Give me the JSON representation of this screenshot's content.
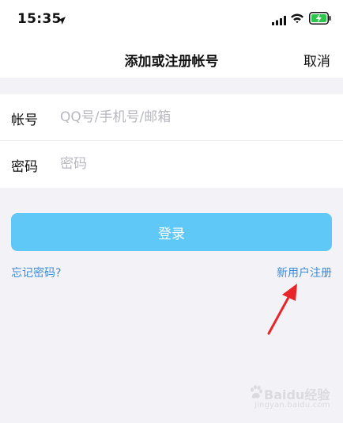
{
  "status_bar": {
    "time": "15:35",
    "icons": [
      "location-arrow-icon",
      "signal-icon",
      "wifi-icon",
      "battery-charging-icon"
    ],
    "battery_color": "#2dc54b"
  },
  "nav": {
    "title": "添加或注册帐号",
    "cancel_label": "取消"
  },
  "form": {
    "account": {
      "label": "帐号",
      "placeholder": "QQ号/手机号/邮箱",
      "value": ""
    },
    "password": {
      "label": "密码",
      "placeholder": "密码",
      "value": ""
    }
  },
  "actions": {
    "login_label": "登录",
    "forgot_label": "忘记密码?",
    "register_label": "新用户注册"
  },
  "colors": {
    "accent": "#5fc8f6",
    "link": "#3d8bd8",
    "background": "#f3f3f7",
    "annotation": "#e8262a"
  },
  "watermark": {
    "brand": "Baidu经验",
    "url": "jingyan.baidu.com"
  }
}
